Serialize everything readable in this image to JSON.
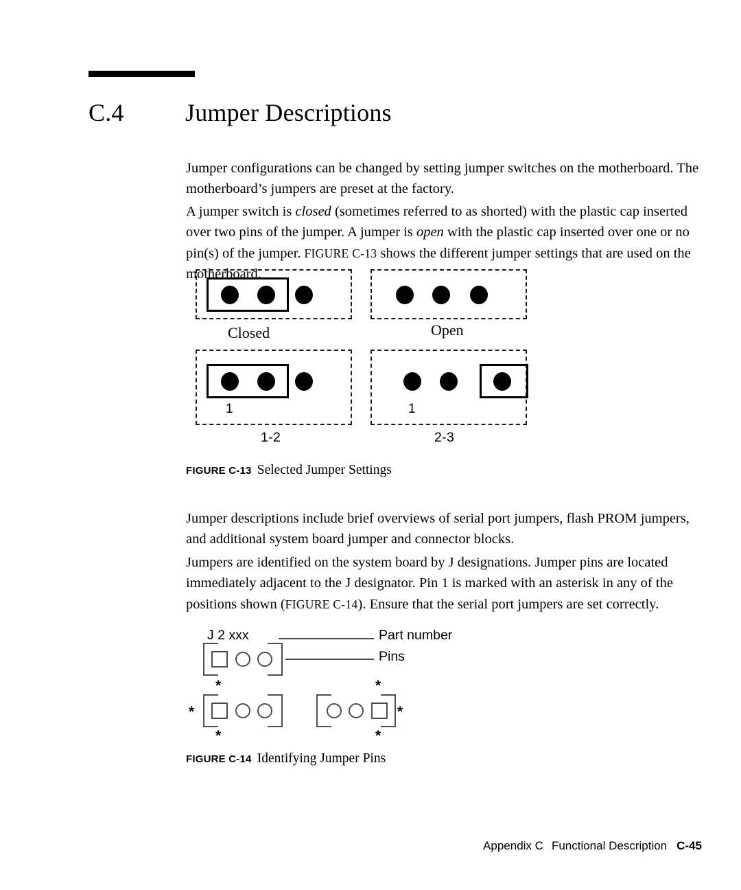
{
  "section": {
    "number": "C.4",
    "title": "Jumper Descriptions"
  },
  "paragraphs": {
    "p1": "Jumper configurations can be changed by setting jumper switches on the motherboard. The motherboard’s jumpers are preset at the factory.",
    "p2_a": "A jumper switch is ",
    "p2_closed": "closed",
    "p2_b": " (sometimes referred to as shorted) with the plastic cap inserted over two pins of the jumper. A jumper is ",
    "p2_open": "open",
    "p2_c": " with the plastic cap inserted over one or no pin(s) of the jumper. ",
    "p2_figref": "FIGURE C-13",
    "p2_d": " shows the different jumper settings that are used on the motherboard.",
    "p3": "Jumper descriptions include brief overviews of serial port jumpers, flash PROM jumpers, and additional system board jumper and connector blocks.",
    "p4_a": "Jumpers are identified on the system board by J designations. Jumper pins are located immediately adjacent to the J designator. Pin 1 is marked with an asterisk in any of the positions shown (",
    "p4_figref": "FIGURE C-14",
    "p4_b": "). Ensure that the serial port jumpers are set correctly."
  },
  "figure_c13": {
    "caption_label": "FIGURE C-13",
    "caption_title": "Selected Jumper Settings",
    "panels": [
      {
        "id": "closed",
        "state_label": "Closed",
        "pin_count": 3,
        "cap_covers": [
          1,
          2
        ],
        "pin_one_label": "",
        "pair_label": ""
      },
      {
        "id": "open",
        "state_label": "Open",
        "pin_count": 3,
        "cap_covers": [],
        "pin_one_label": "",
        "pair_label": ""
      },
      {
        "id": "one-two",
        "state_label": "",
        "pin_count": 3,
        "cap_covers": [
          1,
          2
        ],
        "pin_one_label": "1",
        "pair_label": "1-2"
      },
      {
        "id": "two-three",
        "state_label": "",
        "pin_count": 3,
        "cap_covers": [
          3
        ],
        "pin_one_label": "1",
        "pair_label": "2-3"
      }
    ]
  },
  "figure_c14": {
    "caption_label": "FIGURE C-14",
    "caption_title": "Identifying Jumper Pins",
    "designator": "J 2 xxx",
    "callout_part_number": "Part number",
    "callout_pins": "Pins",
    "asterisk": "*",
    "blocks": [
      {
        "id": "reference",
        "square_side": "left",
        "pin_count": 3,
        "asterisks": []
      },
      {
        "id": "left-marked",
        "square_side": "left",
        "pin_count": 3,
        "asterisks": [
          "top",
          "left",
          "bottom"
        ]
      },
      {
        "id": "right-marked",
        "square_side": "right",
        "pin_count": 3,
        "asterisks": [
          "top",
          "right",
          "bottom"
        ]
      }
    ]
  },
  "footer": {
    "appendix": "Appendix C",
    "chapter": "Functional Description",
    "folio": "C-45"
  }
}
